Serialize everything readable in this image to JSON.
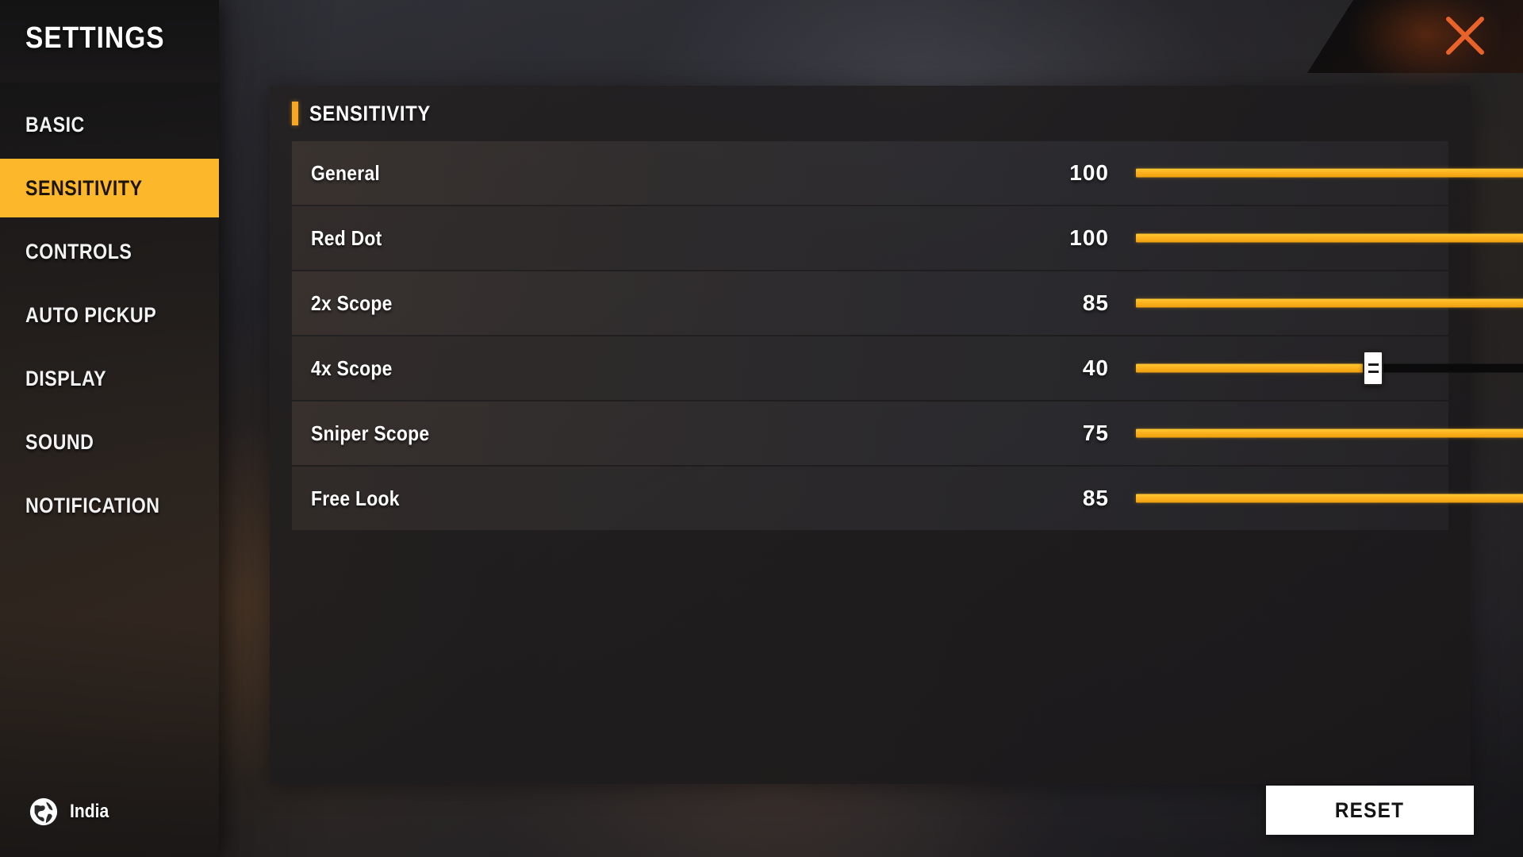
{
  "window": {
    "title": "SETTINGS",
    "close_icon": "close-x-icon",
    "accent_color": "#fcb72b",
    "slider_fill_color": "#fbb01c",
    "close_icon_color": "#e8622a"
  },
  "sidebar": {
    "title": "SETTINGS",
    "items": [
      {
        "label": "BASIC",
        "active": false
      },
      {
        "label": "SENSITIVITY",
        "active": true
      },
      {
        "label": "CONTROLS",
        "active": false
      },
      {
        "label": "AUTO PICKUP",
        "active": false
      },
      {
        "label": "DISPLAY",
        "active": false
      },
      {
        "label": "SOUND",
        "active": false
      },
      {
        "label": "NOTIFICATION",
        "active": false
      }
    ],
    "language": {
      "icon": "globe-icon",
      "label": "India"
    }
  },
  "main": {
    "section_title": "SENSITIVITY",
    "rows": [
      {
        "label": "General",
        "value": "100",
        "percent": 100
      },
      {
        "label": "Red Dot",
        "value": "100",
        "percent": 100
      },
      {
        "label": "2x Scope",
        "value": "85",
        "percent": 85
      },
      {
        "label": "4x Scope",
        "value": "40",
        "percent": 40
      },
      {
        "label": "Sniper Scope",
        "value": "75",
        "percent": 75
      },
      {
        "label": "Free Look",
        "value": "85",
        "percent": 85
      }
    ]
  },
  "footer": {
    "reset_label": "RESET"
  }
}
